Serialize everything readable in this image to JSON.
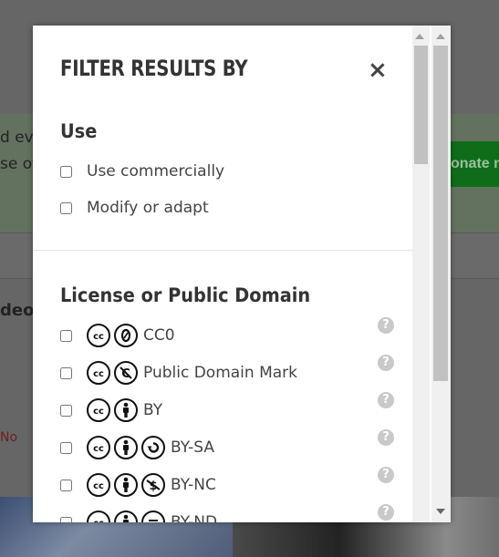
{
  "background": {
    "left_text_lines": [
      "d ev",
      "se of"
    ],
    "donate_text": "onate n",
    "side_label": "deo",
    "no_label": "No"
  },
  "modal": {
    "title": "FILTER RESULTS BY",
    "close_glyph": "×",
    "use_section": {
      "title": "Use",
      "options": [
        {
          "label": "Use commercially"
        },
        {
          "label": "Modify or adapt"
        }
      ]
    },
    "license_section": {
      "title": "License or Public Domain",
      "options": [
        {
          "label": "CC0",
          "icons": [
            "cc-icon",
            "zero-icon"
          ]
        },
        {
          "label": "Public Domain Mark",
          "icons": [
            "cc-icon",
            "pd-icon"
          ]
        },
        {
          "label": "BY",
          "icons": [
            "cc-icon",
            "by-icon"
          ]
        },
        {
          "label": "BY-SA",
          "icons": [
            "cc-icon",
            "by-icon",
            "sa-icon"
          ]
        },
        {
          "label": "BY-NC",
          "icons": [
            "cc-icon",
            "by-icon",
            "nc-icon"
          ]
        },
        {
          "label": "BY-ND",
          "icons": [
            "cc-icon",
            "by-icon",
            "nd-icon"
          ]
        }
      ],
      "help_glyph": "?"
    }
  },
  "colors": {
    "donate_green": "#0f6d1a",
    "help_grey": "#c9c9c9",
    "overlay": "#6b6b6b"
  }
}
